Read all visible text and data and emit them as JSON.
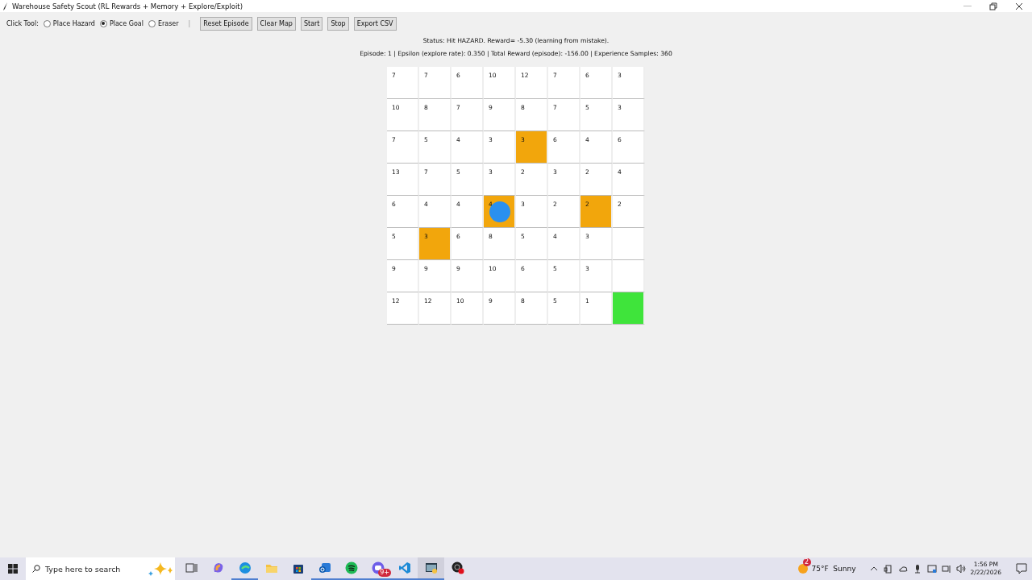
{
  "window": {
    "title": "Warehouse Safety Scout (RL Rewards + Memory + Explore/Exploit)"
  },
  "toolbar": {
    "label": "Click Tool:",
    "tools": [
      {
        "label": "Place Hazard",
        "selected": false
      },
      {
        "label": "Place Goal",
        "selected": true
      },
      {
        "label": "Eraser",
        "selected": false
      }
    ],
    "separator": "|",
    "buttons": [
      "Reset Episode",
      "Clear Map",
      "Start",
      "Stop",
      "Export CSV"
    ]
  },
  "status": "Status: Hit HAZARD. Reward= -5.30 (learning from mistake).",
  "stats": "Episode: 1 | Epsilon (explore rate): 0.350 | Total Reward (episode): -156.00 | Experience Samples: 360",
  "grid": {
    "rows": [
      [
        {
          "kind": "free",
          "value": "7",
          "agent": false
        },
        {
          "kind": "free",
          "value": "7",
          "agent": false
        },
        {
          "kind": "free",
          "value": "6",
          "agent": false
        },
        {
          "kind": "free",
          "value": "10",
          "agent": false
        },
        {
          "kind": "free",
          "value": "12",
          "agent": false
        },
        {
          "kind": "free",
          "value": "7",
          "agent": false
        },
        {
          "kind": "free",
          "value": "6",
          "agent": false
        },
        {
          "kind": "free",
          "value": "3",
          "agent": false
        }
      ],
      [
        {
          "kind": "free",
          "value": "10",
          "agent": false
        },
        {
          "kind": "free",
          "value": "8",
          "agent": false
        },
        {
          "kind": "free",
          "value": "7",
          "agent": false
        },
        {
          "kind": "free",
          "value": "9",
          "agent": false
        },
        {
          "kind": "free",
          "value": "8",
          "agent": false
        },
        {
          "kind": "free",
          "value": "7",
          "agent": false
        },
        {
          "kind": "free",
          "value": "5",
          "agent": false
        },
        {
          "kind": "free",
          "value": "3",
          "agent": false
        }
      ],
      [
        {
          "kind": "free",
          "value": "7",
          "agent": false
        },
        {
          "kind": "free",
          "value": "5",
          "agent": false
        },
        {
          "kind": "free",
          "value": "4",
          "agent": false
        },
        {
          "kind": "free",
          "value": "3",
          "agent": false
        },
        {
          "kind": "hazard",
          "value": "3",
          "agent": false
        },
        {
          "kind": "free",
          "value": "6",
          "agent": false
        },
        {
          "kind": "free",
          "value": "4",
          "agent": false
        },
        {
          "kind": "free",
          "value": "6",
          "agent": false
        }
      ],
      [
        {
          "kind": "free",
          "value": "13",
          "agent": false
        },
        {
          "kind": "free",
          "value": "7",
          "agent": false
        },
        {
          "kind": "free",
          "value": "5",
          "agent": false
        },
        {
          "kind": "free",
          "value": "3",
          "agent": false
        },
        {
          "kind": "free",
          "value": "2",
          "agent": false
        },
        {
          "kind": "free",
          "value": "3",
          "agent": false
        },
        {
          "kind": "free",
          "value": "2",
          "agent": false
        },
        {
          "kind": "free",
          "value": "4",
          "agent": false
        }
      ],
      [
        {
          "kind": "free",
          "value": "6",
          "agent": false
        },
        {
          "kind": "free",
          "value": "4",
          "agent": false
        },
        {
          "kind": "free",
          "value": "4",
          "agent": false
        },
        {
          "kind": "hazard",
          "value": "4",
          "agent": true
        },
        {
          "kind": "free",
          "value": "3",
          "agent": false
        },
        {
          "kind": "free",
          "value": "2",
          "agent": false
        },
        {
          "kind": "hazard",
          "value": "2",
          "agent": false
        },
        {
          "kind": "free",
          "value": "2",
          "agent": false
        }
      ],
      [
        {
          "kind": "free",
          "value": "5",
          "agent": false
        },
        {
          "kind": "hazard",
          "value": "3",
          "agent": false
        },
        {
          "kind": "free",
          "value": "6",
          "agent": false
        },
        {
          "kind": "free",
          "value": "8",
          "agent": false
        },
        {
          "kind": "free",
          "value": "5",
          "agent": false
        },
        {
          "kind": "free",
          "value": "4",
          "agent": false
        },
        {
          "kind": "free",
          "value": "3",
          "agent": false
        },
        {
          "kind": "free",
          "agent": false
        }
      ],
      [
        {
          "kind": "free",
          "value": "9",
          "agent": false
        },
        {
          "kind": "free",
          "value": "9",
          "agent": false
        },
        {
          "kind": "free",
          "value": "9",
          "agent": false
        },
        {
          "kind": "free",
          "value": "10",
          "agent": false
        },
        {
          "kind": "free",
          "value": "6",
          "agent": false
        },
        {
          "kind": "free",
          "value": "5",
          "agent": false
        },
        {
          "kind": "free",
          "value": "3",
          "agent": false
        },
        {
          "kind": "free",
          "agent": false
        }
      ],
      [
        {
          "kind": "free",
          "value": "12",
          "agent": false
        },
        {
          "kind": "free",
          "value": "12",
          "agent": false
        },
        {
          "kind": "free",
          "value": "10",
          "agent": false
        },
        {
          "kind": "free",
          "value": "9",
          "agent": false
        },
        {
          "kind": "free",
          "value": "8",
          "agent": false
        },
        {
          "kind": "free",
          "value": "5",
          "agent": false
        },
        {
          "kind": "free",
          "value": "1",
          "agent": false
        },
        {
          "kind": "goal",
          "agent": false
        }
      ]
    ]
  },
  "taskbar": {
    "search_placeholder": "Type here to search",
    "apps": [
      {
        "kind": "taskview",
        "running": false,
        "selected": false
      },
      {
        "kind": "swirl",
        "running": false,
        "selected": false
      },
      {
        "kind": "globe",
        "running": true,
        "selected": false
      },
      {
        "kind": "folder",
        "running": false,
        "selected": false
      },
      {
        "kind": "bag",
        "running": false,
        "selected": false
      },
      {
        "kind": "mail",
        "running": true,
        "selected": false
      },
      {
        "kind": "music",
        "running": true,
        "selected": false
      },
      {
        "kind": "chat",
        "running": true,
        "selected": false,
        "badge": "9+"
      },
      {
        "kind": "code",
        "running": true,
        "selected": false
      },
      {
        "kind": "window",
        "running": true,
        "selected": true
      },
      {
        "kind": "record",
        "running": false,
        "selected": false
      }
    ],
    "weather": {
      "badge": "2",
      "text": "75°F  Sunny"
    },
    "time": "1:56 PM",
    "date": "2/22/2026"
  }
}
